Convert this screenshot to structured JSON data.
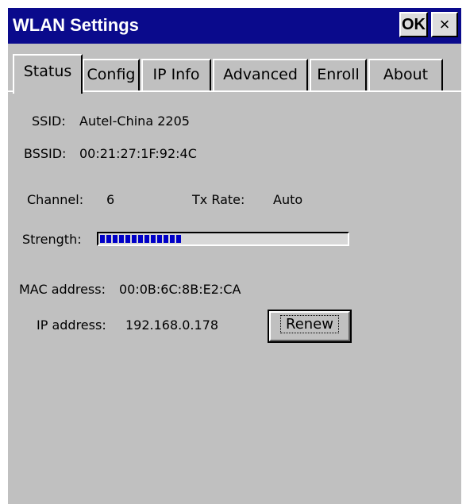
{
  "window": {
    "title": "WLAN Settings",
    "ok_label": "OK",
    "close_label": "×"
  },
  "tabs": [
    {
      "label": "Status",
      "active": true
    },
    {
      "label": "Config"
    },
    {
      "label": "IP Info"
    },
    {
      "label": "Advanced"
    },
    {
      "label": "Enroll"
    },
    {
      "label": "About"
    }
  ],
  "status": {
    "ssid_label": "SSID:",
    "ssid_value": "Autel-China 2205",
    "bssid_label": "BSSID:",
    "bssid_value": "00:21:27:1F:92:4C",
    "channel_label": "Channel:",
    "channel_value": "6",
    "txrate_label": "Tx Rate:",
    "txrate_value": "Auto",
    "strength_label": "Strength:",
    "strength_fraction": 0.33,
    "mac_label": "MAC address:",
    "mac_value": "00:0B:6C:8B:E2:CA",
    "ip_label": "IP address:",
    "ip_value": "192.168.0.178",
    "renew_label": "Renew"
  },
  "colors": {
    "titlebar": "#0a0a8c",
    "window_bg": "#c0c0c0",
    "strength_fill": "#0000c8"
  }
}
